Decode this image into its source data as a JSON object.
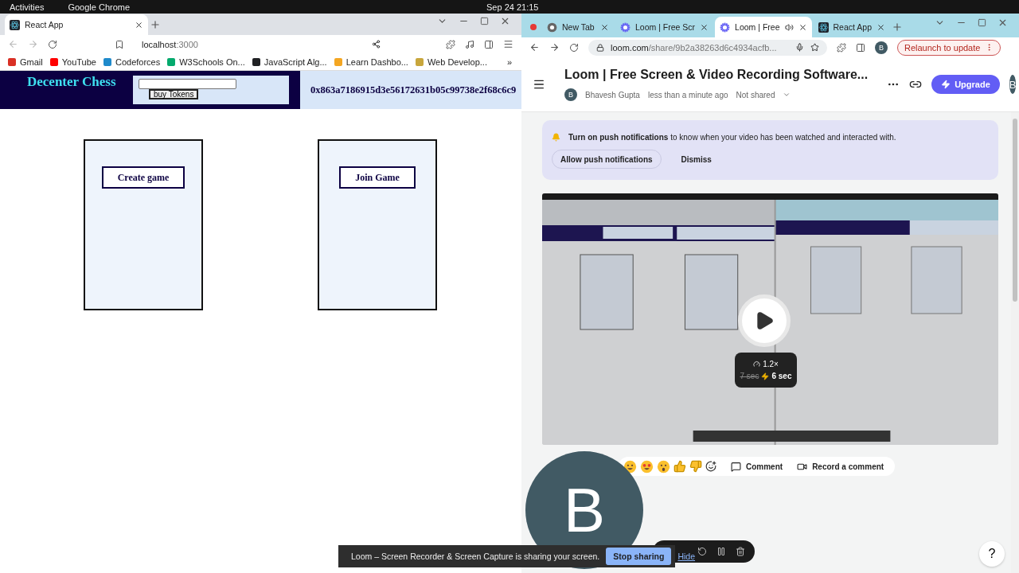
{
  "topbar": {
    "activities": "Activities",
    "app": "Google Chrome",
    "clock": "Sep 24  21:15"
  },
  "left_window": {
    "tabs": [
      {
        "title": "React App",
        "selected": true
      }
    ],
    "address": {
      "host": "localhost",
      "rest": ":3000"
    },
    "bookmarks": [
      {
        "label": "Gmail",
        "color": "#d93025"
      },
      {
        "label": "YouTube",
        "color": "#ff0000"
      },
      {
        "label": "Codeforces",
        "color": "#1f8acb"
      },
      {
        "label": "W3Schools On...",
        "color": "#04aa6d"
      },
      {
        "label": "JavaScript Alg...",
        "color": "#202124"
      },
      {
        "label": "Learn Dashbo...",
        "color": "#f4a622"
      },
      {
        "label": "Web Develop...",
        "color": "#c8a63c"
      }
    ],
    "more": "»",
    "page": {
      "brand": "Decenter Chess",
      "buy_button": "buy Tokens",
      "account": "0x863a7186915d3e56172631b05c99738e2f68c6c9",
      "cards": [
        {
          "button": "Create game"
        },
        {
          "button": "Join Game"
        }
      ]
    }
  },
  "right_window": {
    "tabs": [
      {
        "title": "New Tab",
        "selected": false,
        "kind": "chrome",
        "audio": false
      },
      {
        "title": "Loom | Free Scr",
        "selected": false,
        "kind": "loom",
        "audio": false
      },
      {
        "title": "Loom | Free",
        "selected": true,
        "kind": "loom",
        "audio": true
      },
      {
        "title": "React App",
        "selected": false,
        "kind": "react",
        "audio": false
      }
    ],
    "address": {
      "host": "loom.com",
      "rest": "/share/9b2a38263d6c4934acfb..."
    },
    "profile": "B",
    "relaunch": "Relaunch to update",
    "loom": {
      "title": "Loom | Free Screen & Video Recording Software...",
      "owner_initial": "B",
      "owner": "Bhavesh Gupta",
      "time": "less than a minute ago",
      "sharing": "Not shared",
      "upgrade": "Upgrade",
      "avatar": "B",
      "notice": {
        "text": "**Turn on push notifications** to know when your video has been watched and interacted with.",
        "allow": "Allow push notifications",
        "dismiss": "Dismiss"
      },
      "video": {
        "kind": "picture",
        "speed": "1.2×",
        "original_time": "7 sec",
        "fast_time": "6 sec"
      },
      "comment": "Comment",
      "record": "Record a comment",
      "help": "?"
    }
  },
  "camera_bubble": {
    "initial": "B"
  },
  "share_bar": {
    "text": "Loom – Screen Recorder & Screen Capture is sharing your screen.",
    "stop": "Stop sharing",
    "hide": "Hide"
  }
}
